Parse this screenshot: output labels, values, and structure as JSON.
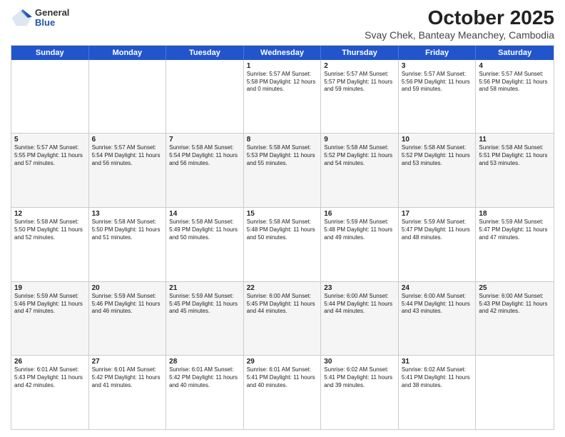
{
  "logo": {
    "general": "General",
    "blue": "Blue"
  },
  "title": "October 2025",
  "subtitle": "Svay Chek, Banteay Meanchey, Cambodia",
  "header_days": [
    "Sunday",
    "Monday",
    "Tuesday",
    "Wednesday",
    "Thursday",
    "Friday",
    "Saturday"
  ],
  "rows": [
    [
      {
        "day": "",
        "info": ""
      },
      {
        "day": "",
        "info": ""
      },
      {
        "day": "",
        "info": ""
      },
      {
        "day": "1",
        "info": "Sunrise: 5:57 AM\nSunset: 5:58 PM\nDaylight: 12 hours\nand 0 minutes."
      },
      {
        "day": "2",
        "info": "Sunrise: 5:57 AM\nSunset: 5:57 PM\nDaylight: 11 hours\nand 59 minutes."
      },
      {
        "day": "3",
        "info": "Sunrise: 5:57 AM\nSunset: 5:56 PM\nDaylight: 11 hours\nand 59 minutes."
      },
      {
        "day": "4",
        "info": "Sunrise: 5:57 AM\nSunset: 5:56 PM\nDaylight: 11 hours\nand 58 minutes."
      }
    ],
    [
      {
        "day": "5",
        "info": "Sunrise: 5:57 AM\nSunset: 5:55 PM\nDaylight: 11 hours\nand 57 minutes."
      },
      {
        "day": "6",
        "info": "Sunrise: 5:57 AM\nSunset: 5:54 PM\nDaylight: 11 hours\nand 56 minutes."
      },
      {
        "day": "7",
        "info": "Sunrise: 5:58 AM\nSunset: 5:54 PM\nDaylight: 11 hours\nand 56 minutes."
      },
      {
        "day": "8",
        "info": "Sunrise: 5:58 AM\nSunset: 5:53 PM\nDaylight: 11 hours\nand 55 minutes."
      },
      {
        "day": "9",
        "info": "Sunrise: 5:58 AM\nSunset: 5:52 PM\nDaylight: 11 hours\nand 54 minutes."
      },
      {
        "day": "10",
        "info": "Sunrise: 5:58 AM\nSunset: 5:52 PM\nDaylight: 11 hours\nand 53 minutes."
      },
      {
        "day": "11",
        "info": "Sunrise: 5:58 AM\nSunset: 5:51 PM\nDaylight: 11 hours\nand 53 minutes."
      }
    ],
    [
      {
        "day": "12",
        "info": "Sunrise: 5:58 AM\nSunset: 5:50 PM\nDaylight: 11 hours\nand 52 minutes."
      },
      {
        "day": "13",
        "info": "Sunrise: 5:58 AM\nSunset: 5:50 PM\nDaylight: 11 hours\nand 51 minutes."
      },
      {
        "day": "14",
        "info": "Sunrise: 5:58 AM\nSunset: 5:49 PM\nDaylight: 11 hours\nand 50 minutes."
      },
      {
        "day": "15",
        "info": "Sunrise: 5:58 AM\nSunset: 5:48 PM\nDaylight: 11 hours\nand 50 minutes."
      },
      {
        "day": "16",
        "info": "Sunrise: 5:59 AM\nSunset: 5:48 PM\nDaylight: 11 hours\nand 49 minutes."
      },
      {
        "day": "17",
        "info": "Sunrise: 5:59 AM\nSunset: 5:47 PM\nDaylight: 11 hours\nand 48 minutes."
      },
      {
        "day": "18",
        "info": "Sunrise: 5:59 AM\nSunset: 5:47 PM\nDaylight: 11 hours\nand 47 minutes."
      }
    ],
    [
      {
        "day": "19",
        "info": "Sunrise: 5:59 AM\nSunset: 5:46 PM\nDaylight: 11 hours\nand 47 minutes."
      },
      {
        "day": "20",
        "info": "Sunrise: 5:59 AM\nSunset: 5:46 PM\nDaylight: 11 hours\nand 46 minutes."
      },
      {
        "day": "21",
        "info": "Sunrise: 5:59 AM\nSunset: 5:45 PM\nDaylight: 11 hours\nand 45 minutes."
      },
      {
        "day": "22",
        "info": "Sunrise: 6:00 AM\nSunset: 5:45 PM\nDaylight: 11 hours\nand 44 minutes."
      },
      {
        "day": "23",
        "info": "Sunrise: 6:00 AM\nSunset: 5:44 PM\nDaylight: 11 hours\nand 44 minutes."
      },
      {
        "day": "24",
        "info": "Sunrise: 6:00 AM\nSunset: 5:44 PM\nDaylight: 11 hours\nand 43 minutes."
      },
      {
        "day": "25",
        "info": "Sunrise: 6:00 AM\nSunset: 5:43 PM\nDaylight: 11 hours\nand 42 minutes."
      }
    ],
    [
      {
        "day": "26",
        "info": "Sunrise: 6:01 AM\nSunset: 5:43 PM\nDaylight: 11 hours\nand 42 minutes."
      },
      {
        "day": "27",
        "info": "Sunrise: 6:01 AM\nSunset: 5:42 PM\nDaylight: 11 hours\nand 41 minutes."
      },
      {
        "day": "28",
        "info": "Sunrise: 6:01 AM\nSunset: 5:42 PM\nDaylight: 11 hours\nand 40 minutes."
      },
      {
        "day": "29",
        "info": "Sunrise: 6:01 AM\nSunset: 5:41 PM\nDaylight: 11 hours\nand 40 minutes."
      },
      {
        "day": "30",
        "info": "Sunrise: 6:02 AM\nSunset: 5:41 PM\nDaylight: 11 hours\nand 39 minutes."
      },
      {
        "day": "31",
        "info": "Sunrise: 6:02 AM\nSunset: 5:41 PM\nDaylight: 11 hours\nand 38 minutes."
      },
      {
        "day": "",
        "info": ""
      }
    ]
  ]
}
